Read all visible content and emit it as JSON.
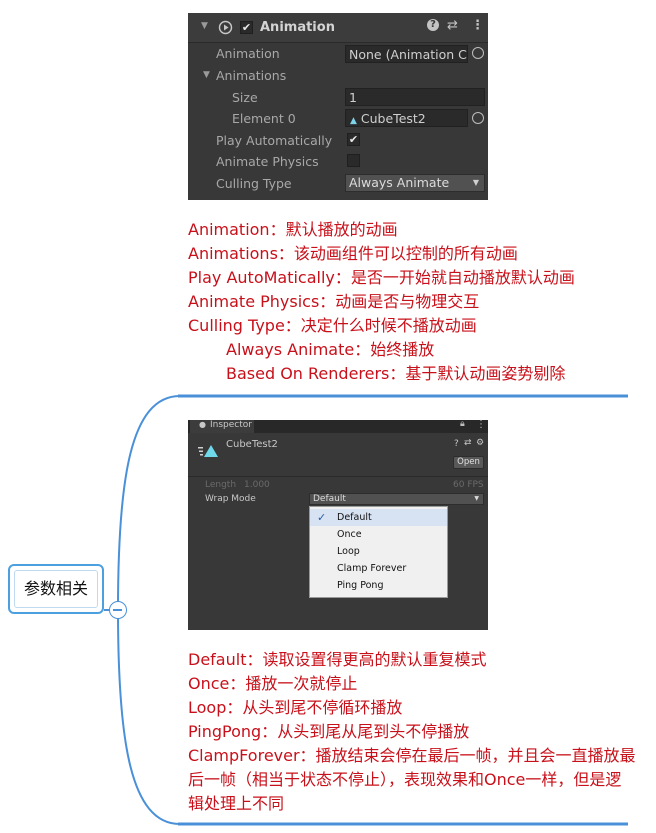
{
  "animation_component": {
    "title": "Animation",
    "rows": {
      "animation_label": "Animation",
      "animation_value": "None (Animation Cl",
      "animations_label": "Animations",
      "size_label": "Size",
      "size_value": "1",
      "element0_label": "Element 0",
      "element0_value": "CubeTest2",
      "play_auto_label": "Play Automatically",
      "play_auto_checked": true,
      "animate_physics_label": "Animate Physics",
      "animate_physics_checked": false,
      "culling_label": "Culling Type",
      "culling_value": "Always Animate"
    }
  },
  "notes_top": [
    "Animation：默认播放的动画",
    "Animations：该动画组件可以控制的所有动画",
    "Play AutoMatically：是否一开始就自动播放默认动画",
    "Animate Physics：动画是否与物理交互",
    "Culling Type：决定什么时候不播放动画",
    "Always Animate：始终播放",
    "Based On Renderers：基于默认动画姿势剔除"
  ],
  "mind_node": {
    "label": "参数相关"
  },
  "inspector": {
    "tab_label": "Inspector",
    "asset_name": "CubeTest2",
    "open_button": "Open",
    "length_label": "Length",
    "length_value": "1.000",
    "fps": "60 FPS",
    "wrap_mode_label": "Wrap Mode",
    "wrap_mode_value": "Default",
    "menu_items": [
      "Default",
      "Once",
      "Loop",
      "Clamp Forever",
      "Ping Pong"
    ],
    "selected_item": "Default"
  },
  "notes_bottom": [
    "Default：读取设置得更高的默认重复模式",
    "Once：播放一次就停止",
    "Loop：从头到尾不停循环播放",
    "PingPong：从头到尾从尾到头不停播放",
    "ClampForever：播放结束会停在最后一帧，并且会一直播放最后一帧（相当于状态不停止），表现效果和Once一样，但是逻辑处理上不同"
  ],
  "colors": {
    "note_red": "#c8101a",
    "branch_blue": "#4a90d9",
    "unity_dark": "#383838"
  }
}
